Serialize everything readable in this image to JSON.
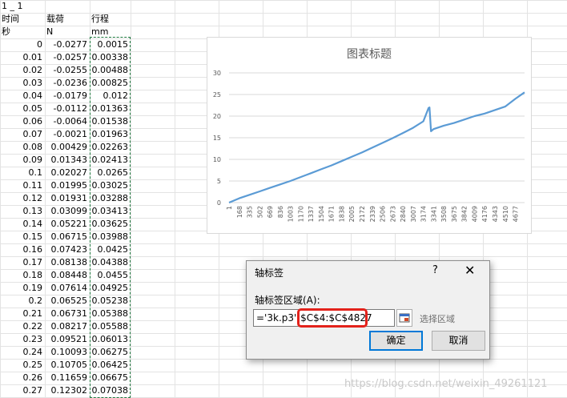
{
  "sheet": {
    "header_row1": {
      "col_a": "1 _ 1"
    },
    "header_row2": {
      "col_a": "时间",
      "col_b": "载荷",
      "col_c": "行程"
    },
    "header_row3": {
      "col_a": "秒",
      "col_b": "N",
      "col_c": "mm"
    },
    "rows": [
      [
        "0",
        "-0.0277",
        "0.0015"
      ],
      [
        "0.01",
        "-0.0257",
        "0.00338"
      ],
      [
        "0.02",
        "-0.0255",
        "0.00488"
      ],
      [
        "0.03",
        "-0.0236",
        "0.00825"
      ],
      [
        "0.04",
        "-0.0179",
        "0.012"
      ],
      [
        "0.05",
        "-0.0112",
        "0.01363"
      ],
      [
        "0.06",
        "-0.0064",
        "0.01538"
      ],
      [
        "0.07",
        "-0.0021",
        "0.01963"
      ],
      [
        "0.08",
        "0.00429",
        "0.02263"
      ],
      [
        "0.09",
        "0.01343",
        "0.02413"
      ],
      [
        "0.1",
        "0.02027",
        "0.0265"
      ],
      [
        "0.11",
        "0.01995",
        "0.03025"
      ],
      [
        "0.12",
        "0.01931",
        "0.03288"
      ],
      [
        "0.13",
        "0.03099",
        "0.03413"
      ],
      [
        "0.14",
        "0.05221",
        "0.03625"
      ],
      [
        "0.15",
        "0.06715",
        "0.03988"
      ],
      [
        "0.16",
        "0.07423",
        "0.0425"
      ],
      [
        "0.17",
        "0.08138",
        "0.04388"
      ],
      [
        "0.18",
        "0.08448",
        "0.0455"
      ],
      [
        "0.19",
        "0.07614",
        "0.04925"
      ],
      [
        "0.2",
        "0.06525",
        "0.05238"
      ],
      [
        "0.21",
        "0.06731",
        "0.05388"
      ],
      [
        "0.22",
        "0.08217",
        "0.05588"
      ],
      [
        "0.23",
        "0.09521",
        "0.06013"
      ],
      [
        "0.24",
        "0.10093",
        "0.06275"
      ],
      [
        "0.25",
        "0.10705",
        "0.06425"
      ],
      [
        "0.26",
        "0.11659",
        "0.06675"
      ],
      [
        "0.27",
        "0.12302",
        "0.07038"
      ]
    ]
  },
  "chart": {
    "title": "图表标题",
    "chart_data": {
      "type": "line",
      "title": "图表标题",
      "xlabel": "",
      "ylabel": "",
      "ylim": [
        0,
        30
      ],
      "yticks": [
        "0",
        "5",
        "10",
        "15",
        "20",
        "25",
        "30"
      ],
      "categories": [
        "1",
        "168",
        "335",
        "502",
        "669",
        "836",
        "1003",
        "1170",
        "1337",
        "1504",
        "1671",
        "1838",
        "2005",
        "2172",
        "2339",
        "2506",
        "2673",
        "2840",
        "3007",
        "3174",
        "3341",
        "3508",
        "3675",
        "3842",
        "4009",
        "4176",
        "4343",
        "4510",
        "4677"
      ],
      "series": [
        {
          "color": "#5b9bd5",
          "x": [
            1,
            168,
            335,
            502,
            669,
            836,
            1003,
            1170,
            1337,
            1504,
            1671,
            1838,
            2005,
            2172,
            2339,
            2506,
            2673,
            2840,
            3007,
            3174,
            3260,
            3275,
            3300,
            3341,
            3508,
            3675,
            3842,
            4009,
            4176,
            4343,
            4510,
            4677,
            4827
          ],
          "values": [
            0,
            1.0,
            1.8,
            2.6,
            3.4,
            4.2,
            5.0,
            5.9,
            6.8,
            7.7,
            8.6,
            9.6,
            10.6,
            11.6,
            12.7,
            13.8,
            14.9,
            16.1,
            17.3,
            18.8,
            21.9,
            22.0,
            16.5,
            17.0,
            17.8,
            18.4,
            19.2,
            20.0,
            20.6,
            21.4,
            22.2,
            24.0,
            25.5
          ]
        }
      ],
      "grid": true,
      "legend": "none"
    }
  },
  "dialog": {
    "title": "轴标签",
    "help": "?",
    "close": "✕",
    "range_label": "轴标签区域(A):",
    "range_value": "='3k.p3'!$C$4:$C$4827",
    "select_area": "选择区域",
    "ok_label": "确定",
    "cancel_label": "取消"
  },
  "watermark": "https://blog.csdn.net/weixin_49261121"
}
